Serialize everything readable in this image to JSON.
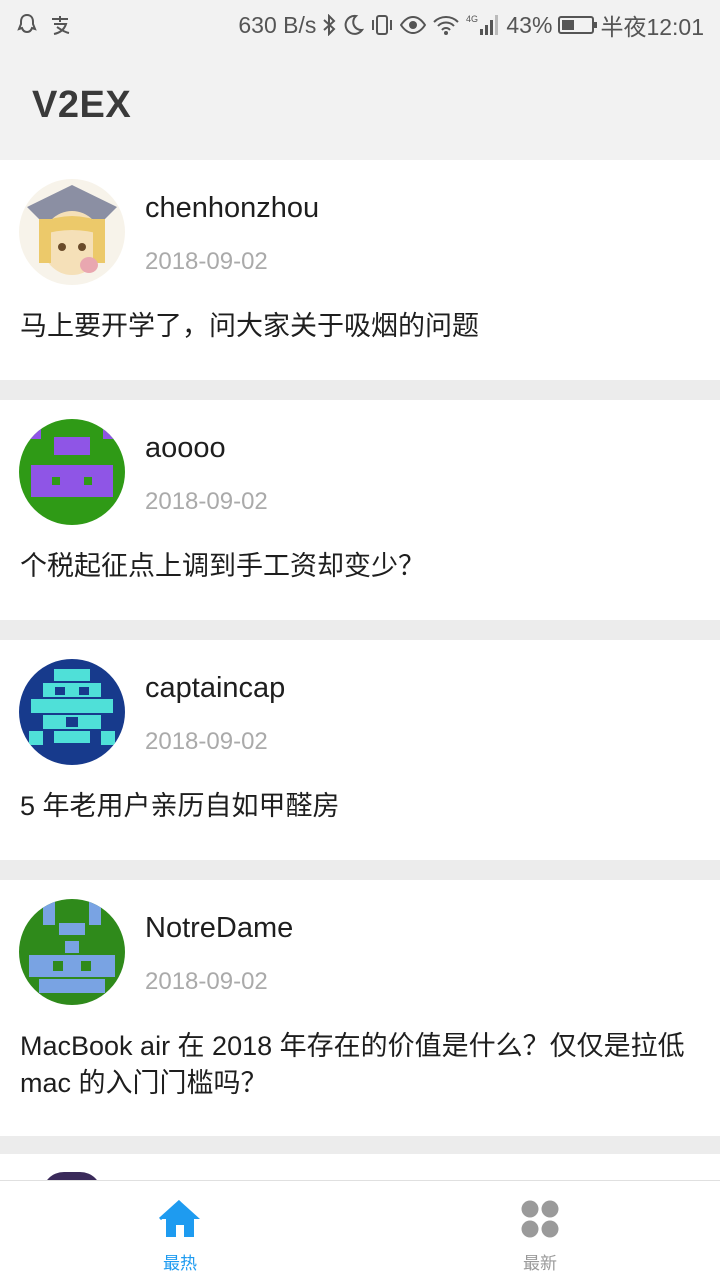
{
  "status_bar": {
    "left_icons": [
      "qq-icon",
      "alipay-icon"
    ],
    "net_speed": "630 B/s",
    "network": "4G",
    "battery": "43%",
    "battery_level": 0.43,
    "time": "半夜12:01"
  },
  "app_bar": {
    "title": "V2EX"
  },
  "topics": [
    {
      "username": "chenhonzhou",
      "date": "2018-09-02",
      "title": "马上要开学了，问大家关于吸烟的问题",
      "avatar": "anime-avatar"
    },
    {
      "username": "aoooo",
      "date": "2018-09-02",
      "title": "个税起征点上调到手工资却变少？",
      "avatar": "identicon-purple-green"
    },
    {
      "username": "captaincap",
      "date": "2018-09-02",
      "title": "5 年老用户亲历自如甲醛房",
      "avatar": "identicon-cyan-navy"
    },
    {
      "username": "NotreDame",
      "date": "2018-09-02",
      "title": "MacBook air 在 2018 年存在的价值是什么？仅仅是拉低 mac 的入门门槛吗？",
      "avatar": "identicon-blue-green"
    }
  ],
  "tabs": [
    {
      "label": "最热",
      "icon": "home-icon",
      "active": true
    },
    {
      "label": "最新",
      "icon": "grid-icon",
      "active": false
    }
  ],
  "colors": {
    "active": "#1e9bf0",
    "inactive": "#9a9a9a",
    "divider": "#ececec"
  }
}
